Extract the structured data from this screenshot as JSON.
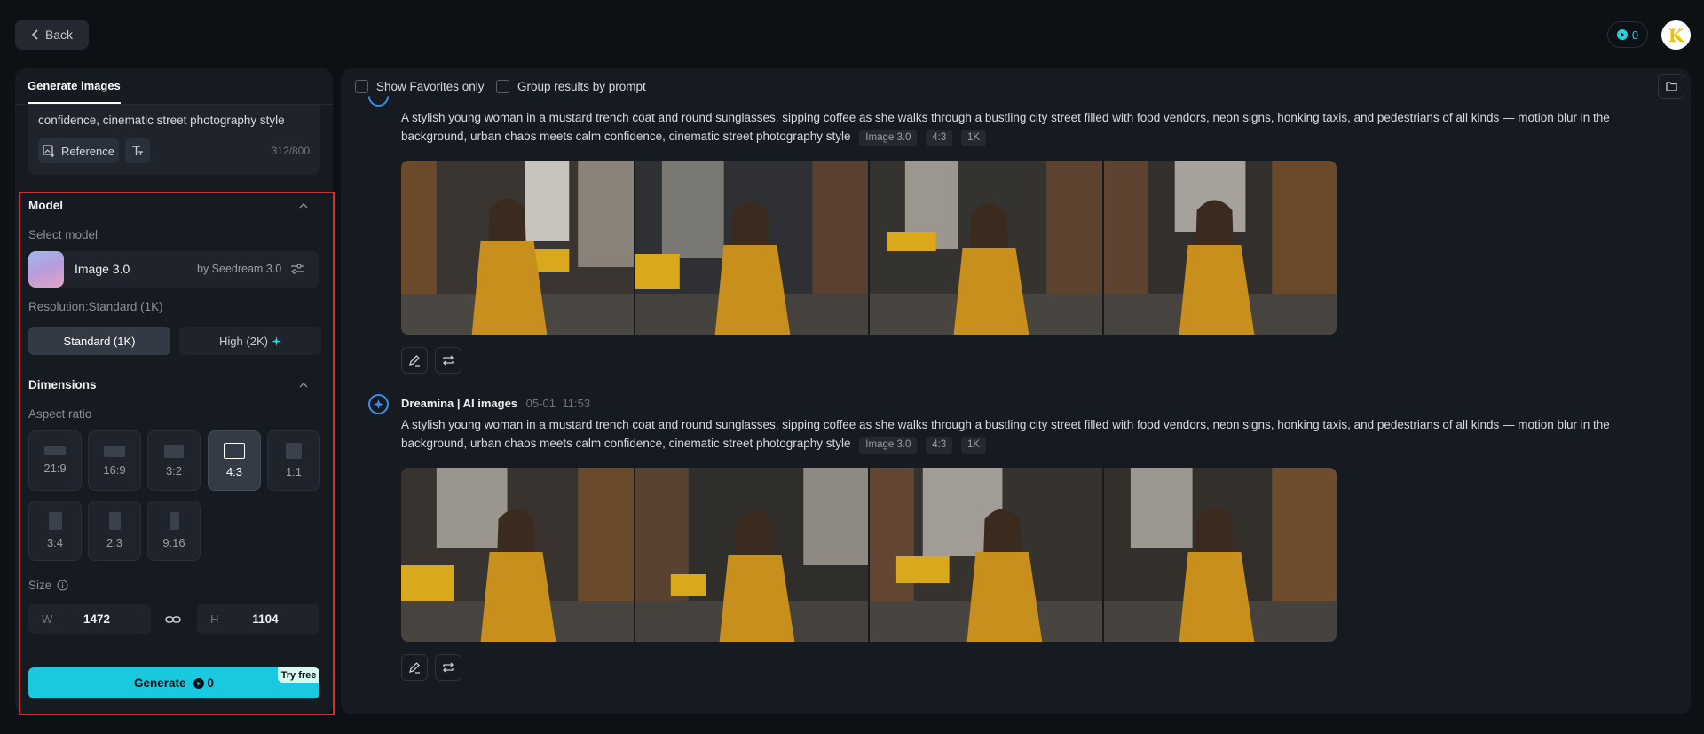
{
  "header": {
    "back_label": "Back",
    "credits": "0"
  },
  "sidebar": {
    "tab": "Generate images",
    "prompt_text": "confidence, cinematic street photography style",
    "reference_label": "Reference",
    "char_count": "312/800",
    "model": {
      "section_title": "Model",
      "select_label": "Select model",
      "model_name": "Image 3.0",
      "model_by": "by Seedream 3.0",
      "resolution_label": "Resolution:Standard (1K)",
      "res_standard": "Standard (1K)",
      "res_high": "High (2K)"
    },
    "dimensions": {
      "section_title": "Dimensions",
      "aspect_label": "Aspect ratio",
      "ratios": [
        "21:9",
        "16:9",
        "3:2",
        "4:3",
        "1:1",
        "3:4",
        "2:3",
        "9:16"
      ],
      "selected_ratio": "4:3",
      "size_label": "Size",
      "w_letter": "W",
      "h_letter": "H",
      "width": "1472",
      "height": "1104"
    },
    "generate_label": "Generate",
    "generate_cost": "0",
    "try_free": "Try free"
  },
  "main": {
    "show_favorites": "Show Favorites only",
    "group_by_prompt": "Group results by prompt",
    "results": [
      {
        "prompt": "A stylish young woman in a mustard trench coat and round sunglasses, sipping coffee as she walks through a bustling city street filled with food vendors, neon signs, honking taxis, and pedestrians of all kinds — motion blur in the background, urban chaos meets calm confidence, cinematic street photography style",
        "tags": [
          "Image 3.0",
          "4:3",
          "1K"
        ]
      },
      {
        "author": "Dreamina | AI images",
        "date": "05-01",
        "time": "11:53",
        "prompt": "A stylish young woman in a mustard trench coat and round sunglasses, sipping coffee as she walks through a bustling city street filled with food vendors, neon signs, honking taxis, and pedestrians of all kinds — motion blur in the background, urban chaos meets calm confidence, cinematic street photography style",
        "tags": [
          "Image 3.0",
          "4:3",
          "1K"
        ]
      }
    ]
  },
  "colors": {
    "accent": "#19c9df",
    "highlight_border": "#e02a2a",
    "background": "#0d1015",
    "panel": "#161a21"
  }
}
